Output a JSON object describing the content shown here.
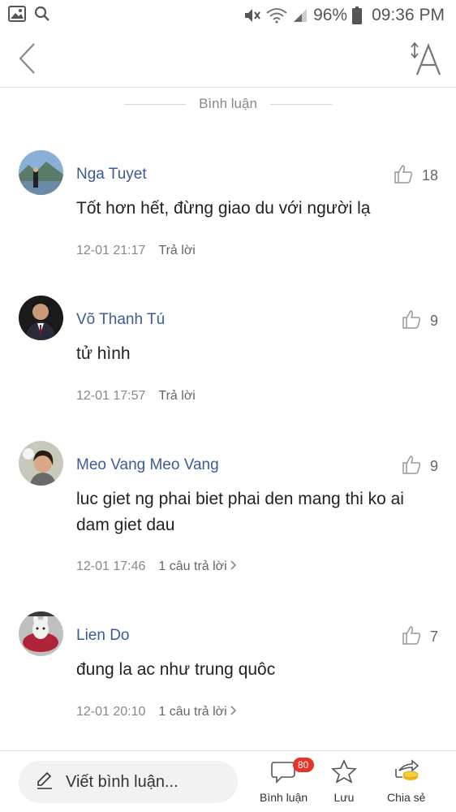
{
  "status_bar": {
    "battery": "96%",
    "time": "09:36 PM",
    "icons": [
      "image-icon",
      "search-icon",
      "mute-icon",
      "wifi-icon",
      "signal-icon",
      "battery-icon"
    ]
  },
  "header": {
    "back_icon": "chevron-left-icon",
    "font_size_icon": "text-size-icon"
  },
  "section": {
    "title": "Bình luận"
  },
  "comments": [
    {
      "name": "Nga Tuyet",
      "likes": "18",
      "text": "Tốt hơn hết, đừng giao du với người lạ",
      "date": "12-01 21:17",
      "reply": "Trả lời"
    },
    {
      "name": "Võ Thanh Tú",
      "likes": "9",
      "text": "tử hình",
      "date": "12-01 17:57",
      "reply": "Trả lời"
    },
    {
      "name": "Meo Vang Meo Vang",
      "likes": "9",
      "text": "luc giet ng phai biet phai den mang thi ko ai dam giet dau",
      "date": "12-01 17:46",
      "reply": "1 câu trả lời"
    },
    {
      "name": "Lien Do",
      "likes": "7",
      "text": "đung la ac như trung quôc",
      "date": "12-01 20:10",
      "reply": "1 câu trả lời"
    }
  ],
  "bottom_bar": {
    "input_placeholder": "Viết bình luận...",
    "comments_label": "Bình luận",
    "comments_badge": "80",
    "save_label": "Lưu",
    "share_label": "Chia sẻ"
  },
  "colors": {
    "name": "#3d5a96",
    "badge": "#e8332a"
  }
}
